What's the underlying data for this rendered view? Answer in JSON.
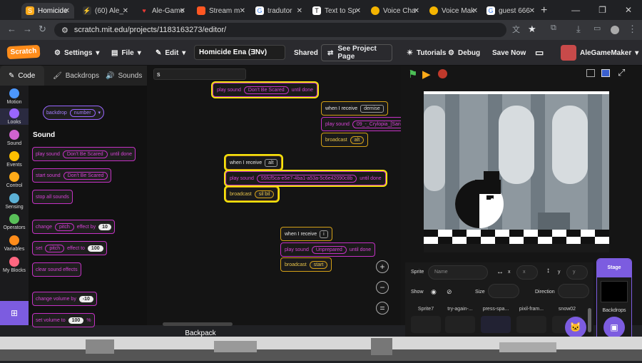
{
  "browser": {
    "tabs": [
      {
        "label": "Homicide",
        "icon": "scratch-icon",
        "color": "#ffab19"
      },
      {
        "label": "(60) Ale_",
        "icon": "lightning-icon",
        "color": "#333333"
      },
      {
        "label": "Ale-Game",
        "icon": "heart-icon",
        "color": "#e53935"
      },
      {
        "label": "Stream m",
        "icon": "stream-icon",
        "color": "#ff5722"
      },
      {
        "label": "tradutor",
        "icon": "google-icon",
        "color": "#4285f4"
      },
      {
        "label": "Text to Sp",
        "icon": "text-icon",
        "color": "#ffffff"
      },
      {
        "label": "Voice Cha",
        "icon": "voice-icon",
        "color": "#f4b400"
      },
      {
        "label": "Voice Mak",
        "icon": "voice-icon",
        "color": "#f4b400"
      },
      {
        "label": "guest 666",
        "icon": "google-icon",
        "color": "#4285f4"
      }
    ],
    "url": "scratch.mit.edu/projects/1183163273/editor/"
  },
  "menubar": {
    "logo": "Scratch",
    "settings": "Settings",
    "file": "File",
    "edit": "Edit",
    "project_title": "Homicide Ena (ƎNv)",
    "shared": "Shared",
    "see_project": "See Project Page",
    "tutorials": "Tutorials",
    "debug": "Debug",
    "save_now": "Save Now",
    "user": "AleGameMaker"
  },
  "tabs": {
    "code": "Code",
    "backdrops": "Backdrops",
    "sounds": "Sounds"
  },
  "categories": [
    {
      "label": "Motion",
      "color": "#4c97ff"
    },
    {
      "label": "Looks",
      "color": "#9966ff"
    },
    {
      "label": "Sound",
      "color": "#cf63cf"
    },
    {
      "label": "Events",
      "color": "#ffbf00"
    },
    {
      "label": "Control",
      "color": "#ffab19"
    },
    {
      "label": "Sensing",
      "color": "#5cb1d6"
    },
    {
      "label": "Operators",
      "color": "#59c059"
    },
    {
      "label": "Variables",
      "color": "#ff8c1a"
    },
    {
      "label": "My Blocks",
      "color": "#ff6680"
    }
  ],
  "palette": {
    "backdrop_number": "backdrop",
    "backdrop_number_pill": "number",
    "section": "Sound",
    "play_sound": "play sound",
    "play_sound_arg": "Don't Be Scared",
    "until_done": "until done",
    "start_sound": "start sound",
    "start_sound_arg": "Don't Be Scared",
    "stop_all": "stop all sounds",
    "change": "change",
    "pitch": "pitch",
    "effect_by": "effect by",
    "change_val": "10",
    "set": "set",
    "effect_to": "effect to",
    "set_val": "100",
    "clear": "clear sound effects",
    "change_volume": "change volume by",
    "volume_val": "-10",
    "set_volume": "set volume to",
    "set_volume_val": "100",
    "percent": "%"
  },
  "workspace": {
    "search": "s",
    "top_play": "play sound",
    "top_play_arg": "Don't Be Scared",
    "top_until": "until done",
    "script1_event": "when I receive",
    "script1_msg": "demise",
    "script1_play": "play sound",
    "script1_arg": "09_-_Crylopia_[Sani",
    "script1_broadcast": "broadcast",
    "script1_bmsg": "alt",
    "script2_event": "when I receive",
    "script2_msg": "alt",
    "script2_play": "play sound",
    "script2_arg": "55fcf5ca-e5e7-4ba1-a53a-5c6e42090c8b",
    "script2_until": "until done",
    "script2_broadcast": "broadcast",
    "script2_bmsg": "sil bil",
    "script3_event": "when I receive",
    "script3_msg": "i",
    "script3_play": "play sound",
    "script3_arg": "Unprepared",
    "script3_until": "until done",
    "script3_broadcast": "broadcast",
    "script3_bmsg": "start",
    "backpack": "Backpack"
  },
  "sprite_info": {
    "sprite": "Sprite",
    "name_placeholder": "Name",
    "x_label": "x",
    "y_label": "y",
    "x_placeholder": "x",
    "y_placeholder": "y",
    "show": "Show",
    "size": "Size",
    "direction": "Direction",
    "stage": "Stage",
    "backdrops": "Backdrops"
  },
  "sprites": [
    "Sprite7",
    "try-again-...",
    "press-spa...",
    "pixil-fram...",
    "snow02"
  ]
}
